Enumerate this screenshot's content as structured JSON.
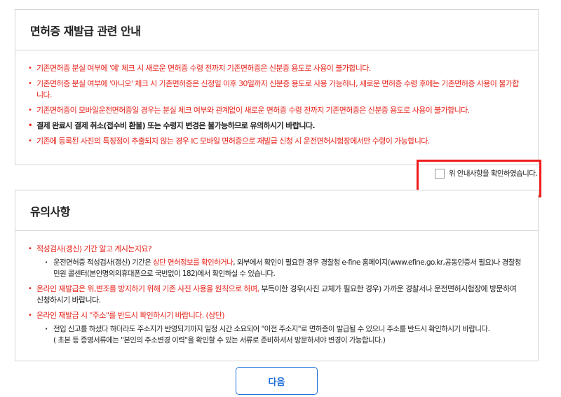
{
  "notice_panel": {
    "title": "면허증 재발급 관련 안내",
    "items": [
      "기존면허증 분실 여부에 '예' 체크 시 새로운 면허증 수령 전까지 기존면허증은 신분증 용도로 사용이 불가합니다.",
      "기존면허증 분실 여부에 '아니오' 체크 시 기존면허증은 신청일 이후 30일까지 신분증 용도로 사용 가능하나, 새로운 면허증 수령 후에는 기존면허증 사용이 불가합니다.",
      "기존면허증이 모바일운전면허증일 경우는 분실 체크 여부와 관계없이 새로운 면허증 수령 전까지 기존면허증은 신분증 용도로 사용이 불가합니다.",
      "결제 완료시 결제 취소(접수비 환불) 또는 수령지 변경은 불가능하므로 유의하시기 바랍니다.",
      "기존에 등록된 사진의 특징점이 추출되지 않는 경우 IC 모바일 면허증으로 재발급 신청 시 운전면허시험장에서만 수령이 가능합니다."
    ]
  },
  "confirm": {
    "label": "위 안내사항을 확인하였습니다."
  },
  "caution_panel": {
    "title": "유의사항",
    "items": [
      {
        "text": "적성검사(갱신) 기간 알고 계시는지요?",
        "sub_pre": "운전면허증 적성검사(갱신) 기간은 ",
        "sub_hl": "상단 면허정보를 확인하거나",
        "sub_post": ", 외부에서 확인이 필요한 경우 경찰청 e-fine 홈페이지(www.efine.go.kr,공동인증서 필요)나 경찰청 민원 콜센터(본인명의의휴대폰으로 국번없이 182)에서 확인하실 수 있습니다."
      },
      {
        "text_red": "온라인 재발급은 위,변조를 방지하기 위해 기존 사진 사용을 원칙으로 하며,",
        "text_black": " 부득이한 경우(사진 교체가 필요한 경우) 가까운 경찰서나 운전면허시험장에 방문하여 신청하시기 바랍니다."
      },
      {
        "text": "온라인 재발급 시 \"주소\"를 반드시 확인하시기 바랍니다. (상단)",
        "sub1": "전입 신고를 하셨다 하더라도 주소지가 반영되기까지 일정 시간 소요되어 \"이전 주소지\"로 면허증이 발급될 수 있으니 주소를 반드시 확인하시기 바랍니다.",
        "sub2": "( 초본 등 증명서류에는 \"본인의 주소변경 이력\"을 확인할 수 있는 서류로 준비하셔서 방문하셔야 변경이 가능합니다.)"
      }
    ]
  },
  "actions": {
    "next_label": "다음"
  }
}
